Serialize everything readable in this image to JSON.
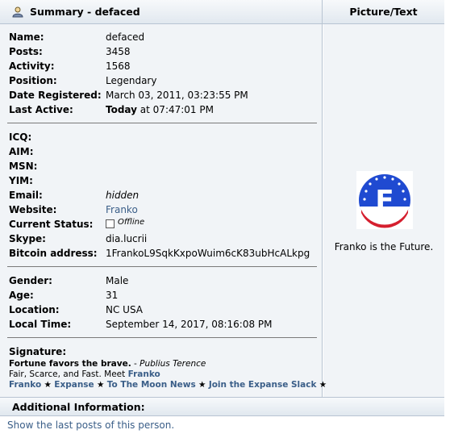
{
  "header": {
    "title": "Summary - defaced",
    "right_title": "Picture/Text"
  },
  "profile": {
    "name_label": "Name:",
    "name": "defaced",
    "posts_label": "Posts:",
    "posts": "3458",
    "activity_label": "Activity:",
    "activity": "1568",
    "position_label": "Position:",
    "position": "Legendary",
    "date_registered_label": "Date Registered:",
    "date_registered": "March 03, 2011, 03:23:55 PM",
    "last_active_label": "Last Active:",
    "last_active_today": "Today",
    "last_active_time": " at 07:47:01 PM"
  },
  "contact": {
    "icq_label": "ICQ:",
    "aim_label": "AIM:",
    "msn_label": "MSN:",
    "yim_label": "YIM:",
    "email_label": "Email:",
    "email": "hidden",
    "website_label": "Website:",
    "website": "Franko",
    "status_label": "Current Status:",
    "status": "Offline",
    "skype_label": "Skype:",
    "skype": "dia.lucrii",
    "bitcoin_label": "Bitcoin address:",
    "bitcoin": "1FrankoL9SqkKxpoWuim6cK83ubHcALkpg"
  },
  "personal": {
    "gender_label": "Gender:",
    "gender": "Male",
    "age_label": "Age:",
    "age": "31",
    "location_label": "Location:",
    "location": "NC USA",
    "local_time_label": "Local Time:",
    "local_time": "September 14, 2017, 08:16:08 PM"
  },
  "signature": {
    "label": "Signature:",
    "line1_bold": "Fortune favors the brave.",
    "line1_rest": " - ",
    "line1_author": "Publius Terence",
    "line2_text": "Fair, Scarce, and Fast. Meet ",
    "line2_link": "Franko",
    "line3_items": [
      "Franko",
      "Expanse",
      "To The Moon News",
      "Join the Expanse Slack"
    ],
    "star": "★"
  },
  "picture": {
    "caption": "Franko is the Future.",
    "logo_letter": "F"
  },
  "additional": {
    "title": "Additional Information:",
    "link": "Show the last posts of this person."
  }
}
